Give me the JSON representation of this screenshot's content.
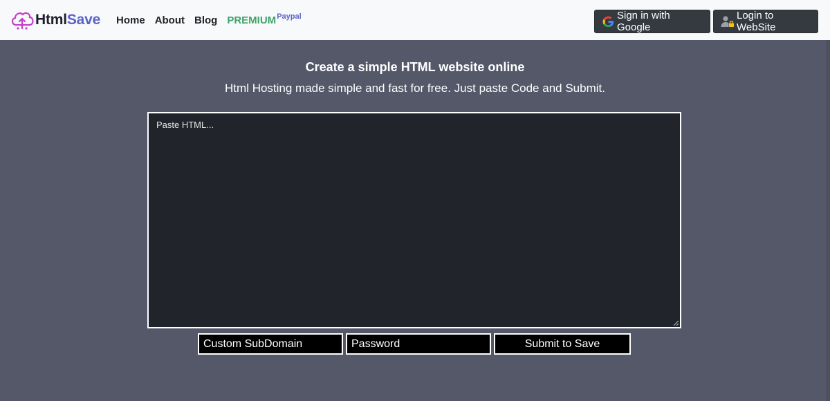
{
  "brand": {
    "name_part1": "Html",
    "name_part2": "Save",
    "icon": "cloud-upload-logo-icon",
    "colors": {
      "dark": "#1f1f2e",
      "accent": "#5b63c8"
    }
  },
  "nav": {
    "home": "Home",
    "about": "About",
    "blog": "Blog",
    "premium": "PREMIUM",
    "premium_sup": "Paypal"
  },
  "auth": {
    "google_label": "Sign in with Google",
    "google_icon": "google-g-icon",
    "login_label": "Login to WebSite",
    "login_icon": "user-lock-icon"
  },
  "hero": {
    "title": "Create a simple HTML website online",
    "subtitle": "Html Hosting made simple and fast for free. Just paste Code and Submit."
  },
  "form": {
    "html_placeholder": "Paste HTML...",
    "subdomain_placeholder": "Custom SubDomain",
    "password_placeholder": "Password",
    "submit_label": "Submit to Save"
  },
  "colors": {
    "page_background": "#545869",
    "header_background": "#f8f9fa",
    "editor_background": "#22242c",
    "premium_green": "#3fa26b"
  }
}
